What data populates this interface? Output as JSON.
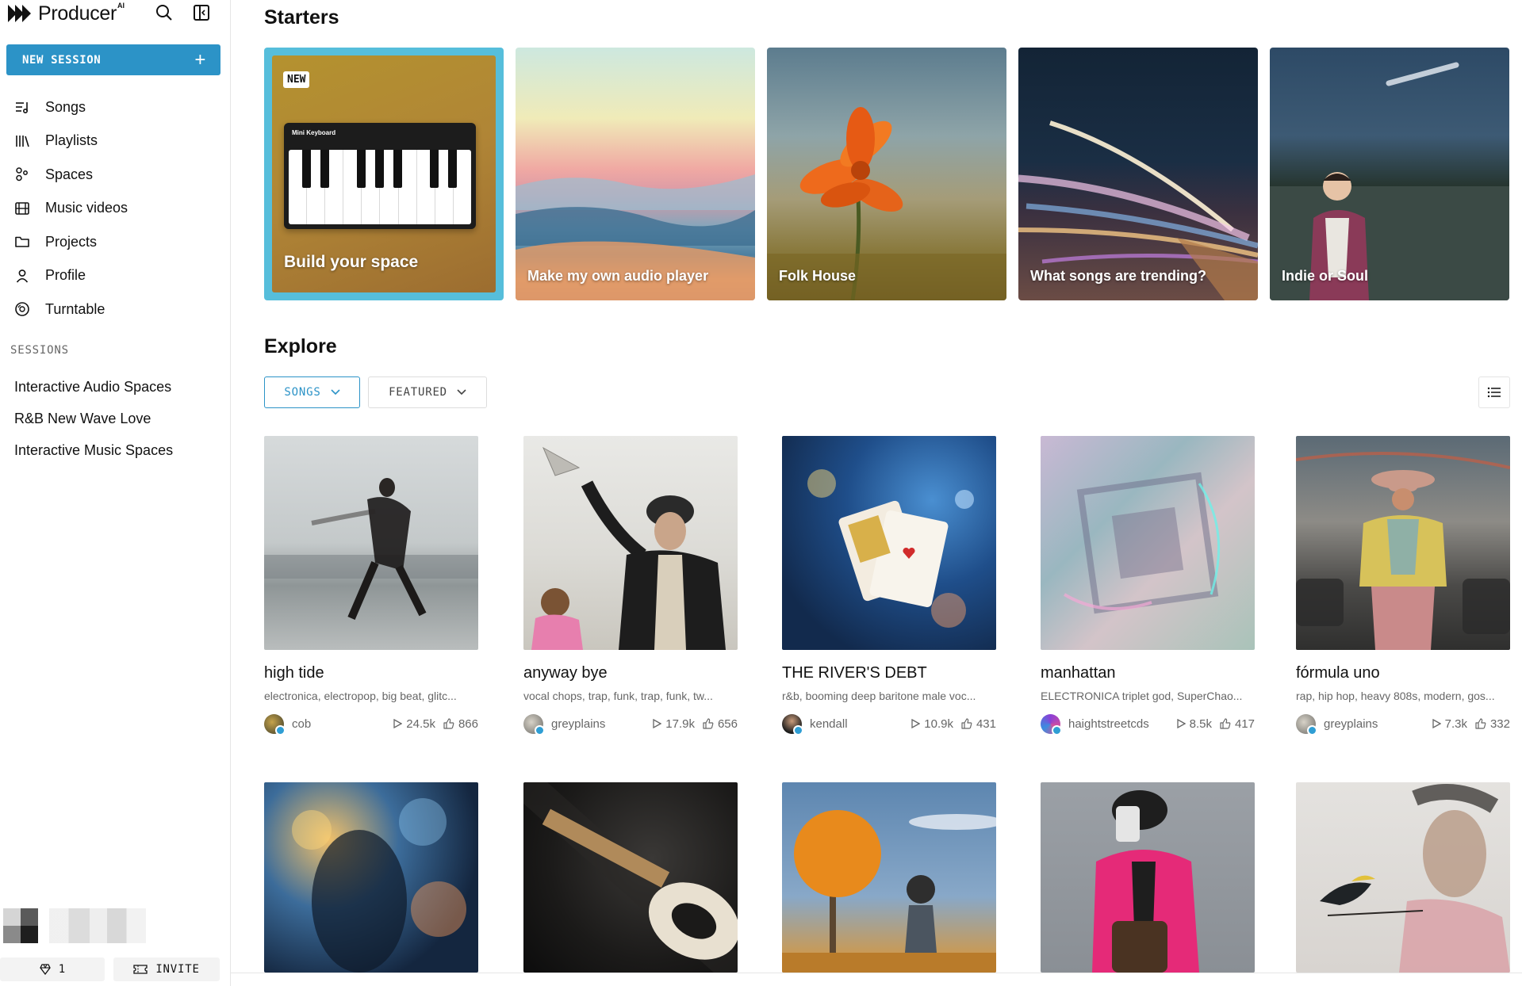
{
  "brand": {
    "name": "Producer",
    "suffix": "AI"
  },
  "sidebar": {
    "new_session_label": "NEW SESSION",
    "nav": [
      {
        "label": "Songs",
        "icon": "songs-icon"
      },
      {
        "label": "Playlists",
        "icon": "playlists-icon"
      },
      {
        "label": "Spaces",
        "icon": "spaces-icon"
      },
      {
        "label": "Music videos",
        "icon": "film-icon"
      },
      {
        "label": "Projects",
        "icon": "folder-icon"
      },
      {
        "label": "Profile",
        "icon": "user-icon"
      },
      {
        "label": "Turntable",
        "icon": "turntable-icon"
      }
    ],
    "sessions_title": "SESSIONS",
    "sessions": [
      "Interactive Audio Spaces",
      "R&B New Wave Love",
      "Interactive Music Spaces"
    ],
    "gems_count": "1",
    "invite_label": "INVITE"
  },
  "starters": {
    "title": "Starters",
    "new_badge": "NEW",
    "keyboard_title": "Mini Keyboard",
    "items": [
      {
        "label": "Build your space"
      },
      {
        "label": "Make my own audio player"
      },
      {
        "label": "Folk House"
      },
      {
        "label": "What songs are trending?"
      },
      {
        "label": "Indie or Soul"
      }
    ]
  },
  "explore": {
    "title": "Explore",
    "filters": [
      {
        "label": "SONGS",
        "active": true
      },
      {
        "label": "FEATURED",
        "active": false
      }
    ],
    "songs": [
      {
        "title": "high tide",
        "tags": "electronica, electropop, big beat, glitc...",
        "author": "cob",
        "plays": "24.5k",
        "likes": "866"
      },
      {
        "title": "anyway bye",
        "tags": "vocal chops, trap, funk, trap, funk, tw...",
        "author": "greyplains",
        "plays": "17.9k",
        "likes": "656"
      },
      {
        "title": "THE RIVER'S DEBT",
        "tags": "r&b, booming deep baritone male voc...",
        "author": "kendall",
        "plays": "10.9k",
        "likes": "431"
      },
      {
        "title": "manhattan",
        "tags": "ELECTRONICA triplet god, SuperChao...",
        "author": "haightstreetcds",
        "plays": "8.5k",
        "likes": "417"
      },
      {
        "title": "fórmula uno",
        "tags": "rap, hip hop, heavy 808s, modern, gos...",
        "author": "greyplains",
        "plays": "7.3k",
        "likes": "332"
      }
    ]
  },
  "colors": {
    "accent": "#2c93c7",
    "starter_highlight": "#56bedb"
  }
}
